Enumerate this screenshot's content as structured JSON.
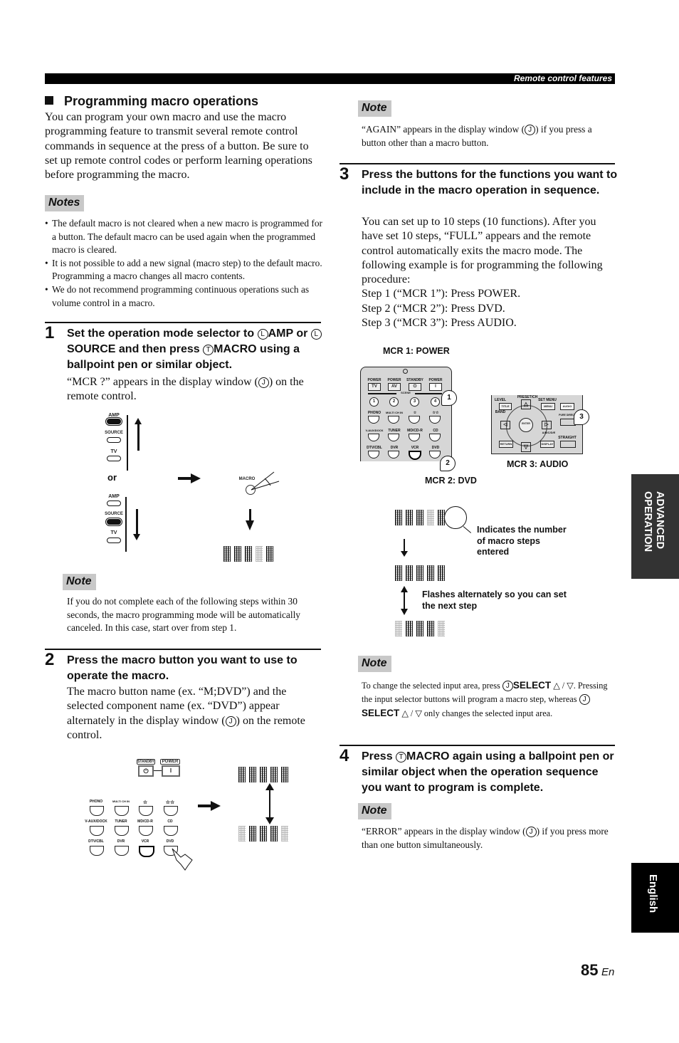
{
  "header": {
    "section": "Remote control features"
  },
  "left": {
    "title": "Programming macro operations",
    "intro": "You can program your own macro and use the macro programming feature to transmit several remote control commands in sequence at the press of a button. Be sure to set up remote control codes or perform learning operations before programming the macro.",
    "notes_label": "Notes",
    "notes": [
      "The default macro is not cleared when a new macro is programmed for a button. The default macro can be used again when the programmed macro is cleared.",
      "It is not possible to add a new signal (macro step) to the default macro. Programming a macro changes all macro contents.",
      "We do not recommend programming continuous operations such as volume control in a macro."
    ],
    "step1": {
      "num": "1",
      "head_a": "Set the operation mode selector to ",
      "key_l": "L",
      "amp": "AMP",
      "or": " or ",
      "source": "SOURCE",
      "head_b": " and then press ",
      "key_t": "T",
      "macro": "MACRO",
      "head_c": " using a ballpoint pen or similar object.",
      "body_a": "“MCR ?” appears in the display window (",
      "key_j": "J",
      "body_b": ") on the remote control.",
      "figure": {
        "selector_labels": [
          "AMP",
          "SOURCE",
          "TV"
        ],
        "or_label": "or",
        "macro_label": "MACRO",
        "display_text": "MCR ?"
      }
    },
    "note1_label": "Note",
    "note1": "If you do not complete each of the following steps within 30 seconds, the macro programming mode will be automatically canceled. In this case, start over from step 1.",
    "step2": {
      "num": "2",
      "head": "Press the macro button you want to use to operate the macro.",
      "body_a": "The macro button name (ex. “M;DVD”) and the selected component name (ex. “DVD”) appear alternately in the display window (",
      "key_j": "J",
      "body_b": ") on the remote control.",
      "figure": {
        "standby_label": "STANDBY",
        "power_label": "POWER",
        "power_symbol": "I",
        "standby_symbol": "⏻",
        "buttons": [
          [
            "PHONO",
            "MULTI CH IN",
            "☆",
            "☆☆"
          ],
          [
            "V-AUX/DOCK",
            "TUNER",
            "MD/CD-R",
            "CD"
          ],
          [
            "DTV/CBL",
            "DVR",
            "VCR",
            "DVD"
          ]
        ],
        "display_top": "M;DVD",
        "display_bottom": "DVD"
      }
    }
  },
  "right": {
    "note_top_label": "Note",
    "note_top_a": "“AGAIN” appears in the display window (",
    "note_top_key": "J",
    "note_top_b": ") if you press a button other than a macro button.",
    "step3": {
      "num": "3",
      "head": "Press the buttons for the functions you want to include in the macro operation in sequence.",
      "body": "You can set up to 10 steps (10 functions). After you have set 10 steps, “FULL” appears and the remote control automatically exits the macro mode. The following example is for programming the following procedure:",
      "steps": [
        "Step 1 (“MCR 1”): Press POWER.",
        "Step 2 (“MCR 2”): Press DVD.",
        "Step 3 (“MCR 3”): Press AUDIO."
      ],
      "figure": {
        "mcr1_label": "MCR 1: POWER",
        "mcr2_label": "MCR 2: DVD",
        "mcr3_label": "MCR 3: AUDIO",
        "remote_top_labels": [
          "POWER",
          "POWER",
          "STANDBY",
          "POWER"
        ],
        "remote_top_buttons": [
          "TV",
          "AV",
          "⏻",
          "I"
        ],
        "scene_label": "SCENE",
        "scene_buttons": [
          "1",
          "2",
          "3",
          "4"
        ],
        "rows": [
          [
            "PHONO",
            "MULTI CH IN",
            "☆",
            "☆☆"
          ],
          [
            "V-AUX/DOCK",
            "TUNER",
            "MD/CD-R",
            "CD"
          ],
          [
            "DTV/CBL",
            "DVR",
            "VCR",
            "DVD"
          ]
        ],
        "callouts": [
          "1",
          "2",
          "3"
        ],
        "nav_labels": {
          "level": "LEVEL",
          "title": "TITLE",
          "band": "BAND",
          "preset": "PRESET/CH",
          "setmenu": "SET MENU",
          "menu": "MENU",
          "audio": "AUDIO",
          "puredirect": "PURE DIRECT",
          "enter": "ENTER",
          "abcde": "A/B/C/D/E",
          "straight": "STRAIGHT",
          "return": "RETURN",
          "display": "DISPLAY"
        }
      }
    },
    "display_seq": {
      "first": "MCR 1",
      "second": "M;DVD",
      "third": "DVD",
      "indicates": "Indicates the number of macro steps entered",
      "flashes": "Flashes alternately so you can set the next step"
    },
    "note_mid_label": "Note",
    "note_mid": {
      "a": "To change the selected input area, press ",
      "key": "J",
      "select": "SELECT",
      "arrows": "△ / ▽",
      "b": ". Pressing the input selector buttons will program a macro step, whereas ",
      "c": " only changes the selected input area."
    },
    "step4": {
      "num": "4",
      "head_a": "Press ",
      "key_t": "T",
      "macro": "MACRO",
      "head_b": " again using a ballpoint pen or similar object when the operation sequence you want to program is complete."
    },
    "note_bottom_label": "Note",
    "note_bottom_a": "“ERROR” appears in the display window (",
    "note_bottom_key": "J",
    "note_bottom_b": ") if you press more than one button simultaneously."
  },
  "side_tabs": {
    "advanced": "ADVANCED OPERATION",
    "language": "English"
  },
  "footer": {
    "page_number": "85",
    "lang_suffix": "En"
  }
}
